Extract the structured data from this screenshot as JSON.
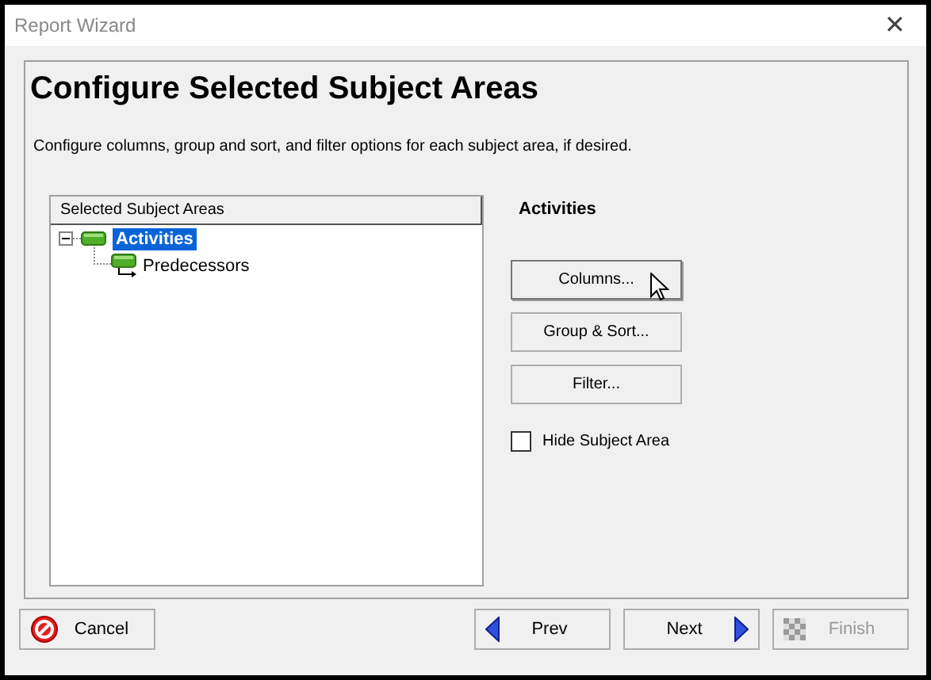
{
  "window": {
    "title": "Report Wizard",
    "close": "✕"
  },
  "heading": "Configure Selected Subject Areas",
  "description": "Configure columns, group and sort, and filter options for each subject area, if desired.",
  "tree": {
    "header": "Selected Subject Areas",
    "items": [
      {
        "label": "Activities",
        "selected": true,
        "expanded": true,
        "children": [
          {
            "label": "Predecessors",
            "selected": false
          }
        ]
      }
    ]
  },
  "detail": {
    "title": "Activities",
    "buttons": [
      {
        "label": "Columns...",
        "hovered": true
      },
      {
        "label": "Group & Sort...",
        "hovered": false
      },
      {
        "label": "Filter...",
        "hovered": false
      }
    ],
    "hide_checkbox": {
      "label": "Hide Subject Area",
      "checked": false
    }
  },
  "footer": [
    {
      "kind": "cancel",
      "label": "Cancel",
      "disabled": false
    },
    {
      "kind": "prev",
      "label": "Prev",
      "disabled": false
    },
    {
      "kind": "next",
      "label": "Next",
      "disabled": false
    },
    {
      "kind": "finish",
      "label": "Finish",
      "disabled": true
    }
  ]
}
